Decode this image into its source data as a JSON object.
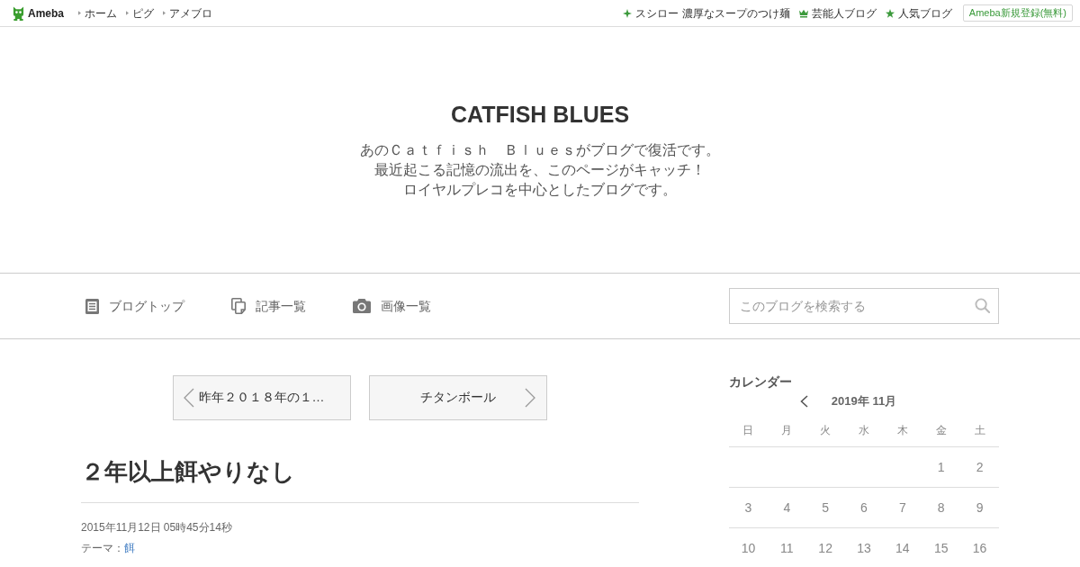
{
  "top_bar": {
    "logo": "Ameba",
    "nav": [
      "ホーム",
      "ピグ",
      "アメブロ"
    ],
    "links": [
      {
        "kind": "sparkle",
        "label": "スシロー 濃厚なスープのつけ麺"
      },
      {
        "kind": "crown",
        "label": "芸能人ブログ"
      },
      {
        "kind": "star",
        "label": "人気ブログ"
      }
    ],
    "signup_button": "Ameba新規登録(無料)"
  },
  "blog_header": {
    "title": "CATFISH BLUES",
    "description": [
      "あのＣａｔｆｉｓｈ　Ｂｌｕｅｓがブログで復活です。",
      "最近起こる記憶の流出を、このページがキャッチ！",
      "ロイヤルプレコを中心としたブログです。"
    ]
  },
  "blog_nav": {
    "items": [
      {
        "kind": "document",
        "label": "ブログトップ"
      },
      {
        "kind": "pages",
        "label": "記事一覧"
      },
      {
        "kind": "camera",
        "label": "画像一覧"
      }
    ],
    "search": {
      "placeholder": "このブログを検索する"
    }
  },
  "pager": {
    "previous": "昨年２０１８年の１…",
    "next": "チタンボール"
  },
  "article": {
    "title": "２年以上餌やりなし",
    "date": "2015年11月12日 05時45分14秒",
    "theme_label": "テーマ：",
    "theme": "餌"
  },
  "calendar": {
    "heading": "カレンダー",
    "month": "2019年 11月",
    "weekdays": [
      "日",
      "月",
      "火",
      "水",
      "木",
      "金",
      "土"
    ],
    "weeks": [
      [
        "1",
        "2"
      ],
      [
        "3",
        "4",
        "5",
        "6",
        "7",
        "8",
        "9"
      ],
      [
        "10",
        "11",
        "12",
        "13",
        "14",
        "15",
        "16"
      ]
    ]
  }
}
